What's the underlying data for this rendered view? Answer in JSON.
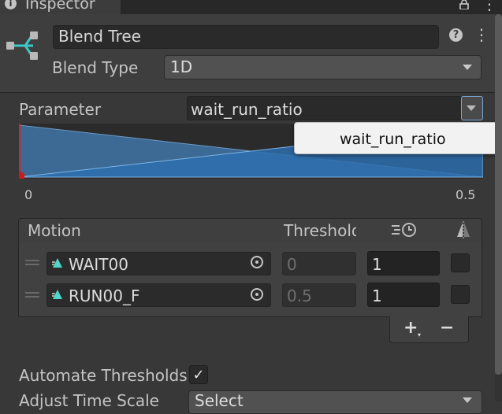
{
  "window": {
    "tab_title": "Inspector",
    "info_icon": "i"
  },
  "header": {
    "name": "Blend Tree",
    "help_icon": "?",
    "menu_icon": "⋮"
  },
  "blend_type": {
    "label": "Blend Type",
    "value": "1D"
  },
  "parameter": {
    "label": "Parameter",
    "value": "wait_run_ratio"
  },
  "popup": {
    "items": [
      "wait_run_ratio"
    ]
  },
  "graph": {
    "min_label": "0",
    "max_label": "0.5",
    "marker_value": 0,
    "range": [
      0,
      0.5
    ]
  },
  "motion_list": {
    "columns": {
      "motion": "Motion",
      "threshold": "Threshold",
      "speed_icon": "speed-icon",
      "mirror_icon": "mirror-icon"
    },
    "rows": [
      {
        "clip": "WAIT00",
        "threshold": "0",
        "speed": "1",
        "mirror": false
      },
      {
        "clip": "RUN00_F",
        "threshold": "0.5",
        "speed": "1",
        "mirror": false
      }
    ],
    "add_label": "+",
    "add_caret": "▾",
    "remove_label": "−"
  },
  "automate_thresholds": {
    "label": "Automate Thresholds",
    "checked": true,
    "check_glyph": "✓"
  },
  "adjust_time_scale": {
    "label": "Adjust Time Scale",
    "value": "Select"
  },
  "colors": {
    "accent_blue": "#3a86c8",
    "marker_red": "#e02020",
    "background": "#383838"
  }
}
